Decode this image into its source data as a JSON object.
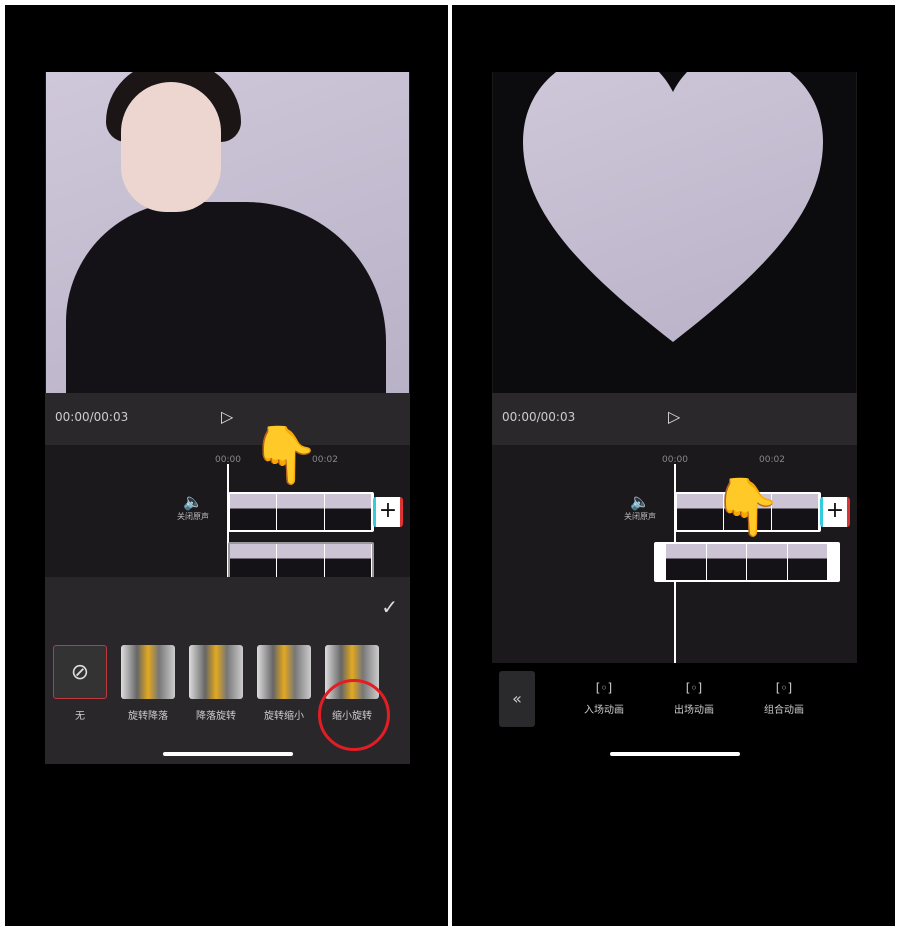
{
  "left": {
    "time": "00:00/00:03",
    "ruler": [
      "00:00",
      "00:02"
    ],
    "mute_label": "关闭原声",
    "animations": [
      {
        "label": "无",
        "icon": "no-entry-icon"
      },
      {
        "label": "旋转降落"
      },
      {
        "label": "降落旋转"
      },
      {
        "label": "旋转缩小"
      },
      {
        "label": "缩小旋转"
      }
    ],
    "highlight_color": "#e21d24",
    "hand": "👇"
  },
  "right": {
    "time": "00:00/00:03",
    "ruler": [
      "00:00",
      "00:02"
    ],
    "mute_label": "关闭原声",
    "tools": [
      {
        "label": "入场动画"
      },
      {
        "label": "出场动画"
      },
      {
        "label": "组合动画"
      }
    ],
    "hand": "👇"
  },
  "icons": {
    "play": "▷",
    "plus": "+",
    "check": "✓",
    "back": "«",
    "speaker": "🔈",
    "bracket": "[◦]"
  }
}
